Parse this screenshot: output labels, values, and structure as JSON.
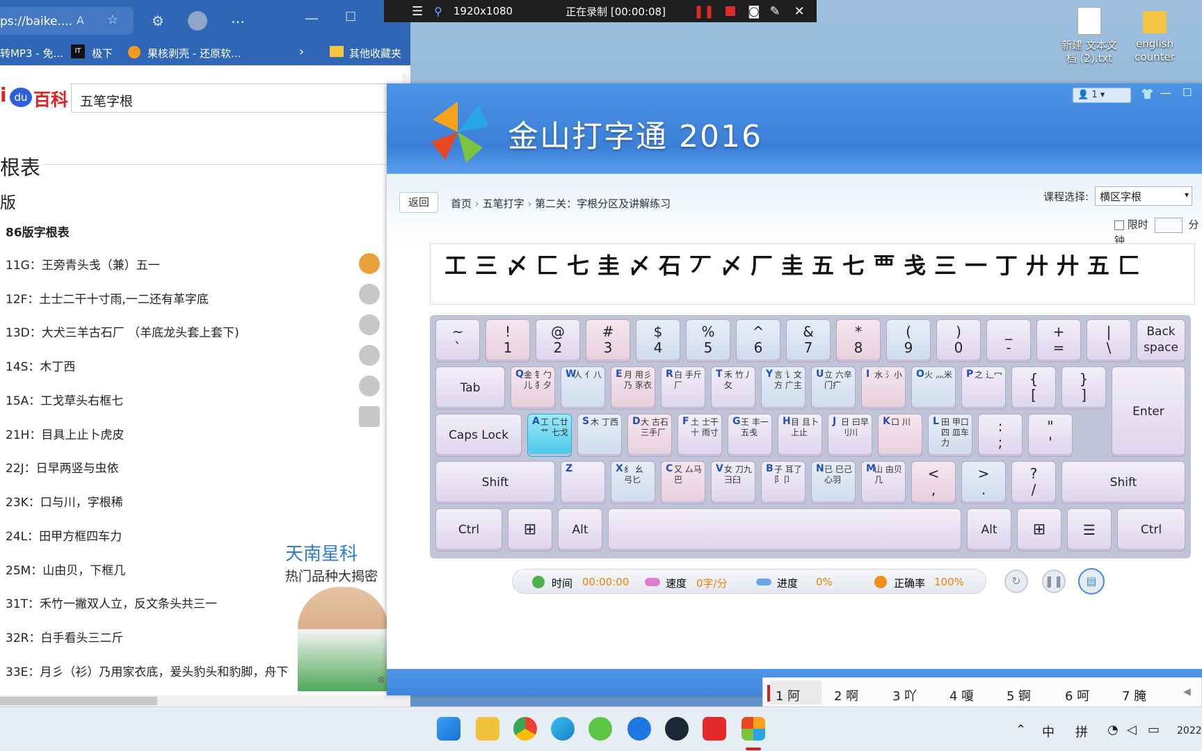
{
  "recording_bar": {
    "resolution": "1920x1080",
    "status": "正在录制 [00:00:08]"
  },
  "browser": {
    "tab_title": "ps://baike....",
    "bookmarks": [
      "转MP3 - 免...",
      "极下",
      "果核剥壳 - 还原软...",
      "其他收藏夹"
    ],
    "logo_text": "百科",
    "search_value": "五笔字根",
    "heading_main": "根表",
    "heading_sub": "版",
    "list_title": "86版字根表",
    "list": [
      "11G：王旁青头戋（兼）五一",
      "12F：土士二干十寸雨,一二还有革字底",
      "13D：大犬三羊古石厂 （羊底龙头套上套下)",
      "14S：木丁西",
      "15A：工戈草头右框七",
      "21H：目具上止卜虎皮",
      "22J：日早两竖与虫依",
      "23K：口与川，字根稀",
      "24L：田甲方框四车力",
      "25M：山由贝，下框几",
      "31T：禾竹一撇双人立，反文条头共三一",
      "32R：白手看头三二斤",
      "33E：月彡（衫）乃用家衣底，爰头豹头和豹脚，舟下"
    ],
    "ad": {
      "title": "天南星科",
      "subtitle": "热门品种大揭密"
    }
  },
  "desktop_icons": [
    {
      "label": "新建 文本文档 (2).txt",
      "icon": "text-file-icon"
    },
    {
      "label": "english counter",
      "icon": "folder-icon"
    }
  ],
  "app": {
    "title": "金山打字通 2016",
    "user_count": "1",
    "back_label": "返回",
    "breadcrumb": [
      "首页",
      "五笔打字",
      "第二关：字根分区及讲解练习"
    ],
    "course_label": "课程选择:",
    "course_value": "横区字根",
    "time_limit_label": "限时",
    "time_limit_unit": "分钟",
    "practice_text": "工三〆匚七圭〆石丆〆厂圭五七覀戋三一丁廾廾五匚",
    "keyboard": {
      "row1": [
        {
          "up": "~",
          "dn": "`"
        },
        {
          "up": "!",
          "dn": "1"
        },
        {
          "up": "@",
          "dn": "2"
        },
        {
          "up": "#",
          "dn": "3"
        },
        {
          "up": "$",
          "dn": "4"
        },
        {
          "up": "%",
          "dn": "5"
        },
        {
          "up": "^",
          "dn": "6"
        },
        {
          "up": "&",
          "dn": "7"
        },
        {
          "up": "*",
          "dn": "8"
        },
        {
          "up": "(",
          "dn": "9"
        },
        {
          "up": ")",
          "dn": "0"
        },
        {
          "up": "_",
          "dn": "-"
        },
        {
          "up": "+",
          "dn": "="
        },
        {
          "up": "|",
          "dn": "\\"
        },
        {
          "up": "Back",
          "dn": "space"
        }
      ],
      "row2": [
        {
          "one": "Tab"
        },
        {
          "ll": "Q",
          "roots": "金 钅勹儿 犭夕"
        },
        {
          "ll": "W",
          "roots": "人 亻八"
        },
        {
          "ll": "E",
          "roots": "月 用彡乃 豕衣"
        },
        {
          "ll": "R",
          "roots": "白 手斤 厂"
        },
        {
          "ll": "T",
          "roots": "禾 竹丿 攵"
        },
        {
          "ll": "Y",
          "roots": "言 讠文方 广主"
        },
        {
          "ll": "U",
          "roots": "立 六辛 门疒"
        },
        {
          "ll": "I",
          "roots": "水 氵小"
        },
        {
          "ll": "O",
          "roots": "火 灬米"
        },
        {
          "ll": "P",
          "roots": "之 辶冖"
        },
        {
          "up": "{",
          "dn": "["
        },
        {
          "up": "}",
          "dn": "]"
        }
      ],
      "enter_label": "Enter",
      "row3": [
        {
          "one": "Caps Lock"
        },
        {
          "ll": "A",
          "roots": "工 匚廿艹 七戈"
        },
        {
          "ll": "S",
          "roots": "木 丁西"
        },
        {
          "ll": "D",
          "roots": "大 古石 三手厂"
        },
        {
          "ll": "F",
          "roots": "土 士干十 雨寸"
        },
        {
          "ll": "G",
          "roots": "王 丰一 五戋"
        },
        {
          "ll": "H",
          "roots": "目 且卜 上止"
        },
        {
          "ll": "J",
          "roots": "日 曰早 刂川"
        },
        {
          "ll": "K",
          "roots": "口 川"
        },
        {
          "ll": "L",
          "roots": "田 甲口四 皿车力"
        },
        {
          "up": ":",
          "dn": ";"
        },
        {
          "up": "\"",
          "dn": "'"
        }
      ],
      "row4": [
        {
          "one": "Shift"
        },
        {
          "ll": "Z",
          "roots": ""
        },
        {
          "ll": "X",
          "roots": "纟 幺 弓匕"
        },
        {
          "ll": "C",
          "roots": "又 厶马 巴"
        },
        {
          "ll": "V",
          "roots": "女 刀九 彐臼"
        },
        {
          "ll": "B",
          "roots": "子 耳了 阝卩"
        },
        {
          "ll": "N",
          "roots": "已 巳己 心羽"
        },
        {
          "ll": "M",
          "roots": "山 由贝 几"
        },
        {
          "up": "<",
          "dn": ","
        },
        {
          "up": ">",
          "dn": "."
        },
        {
          "up": "?",
          "dn": "/"
        },
        {
          "one": "Shift"
        }
      ],
      "row5": [
        "Ctrl",
        "",
        "Alt",
        "",
        "Alt",
        "",
        "",
        "Ctrl"
      ]
    },
    "status": {
      "time_label": "时间",
      "time_value": "00:00:00",
      "speed_label": "速度",
      "speed_value": "0字/分",
      "progress_label": "进度",
      "progress_value": "0%",
      "accuracy_label": "正确率",
      "accuracy_value": "100%"
    }
  },
  "ime": {
    "candidates": [
      "1 阿",
      "2 啊",
      "3 吖",
      "4 嗄",
      "5 锕",
      "6 呵",
      "7 腌"
    ]
  },
  "taskbar": {
    "tray": [
      "中",
      "拼"
    ],
    "date": "2022/"
  },
  "colors": {
    "accent": "#3b7fd8",
    "highlight_key": "#49c6ea",
    "status_value": "#f08000"
  }
}
